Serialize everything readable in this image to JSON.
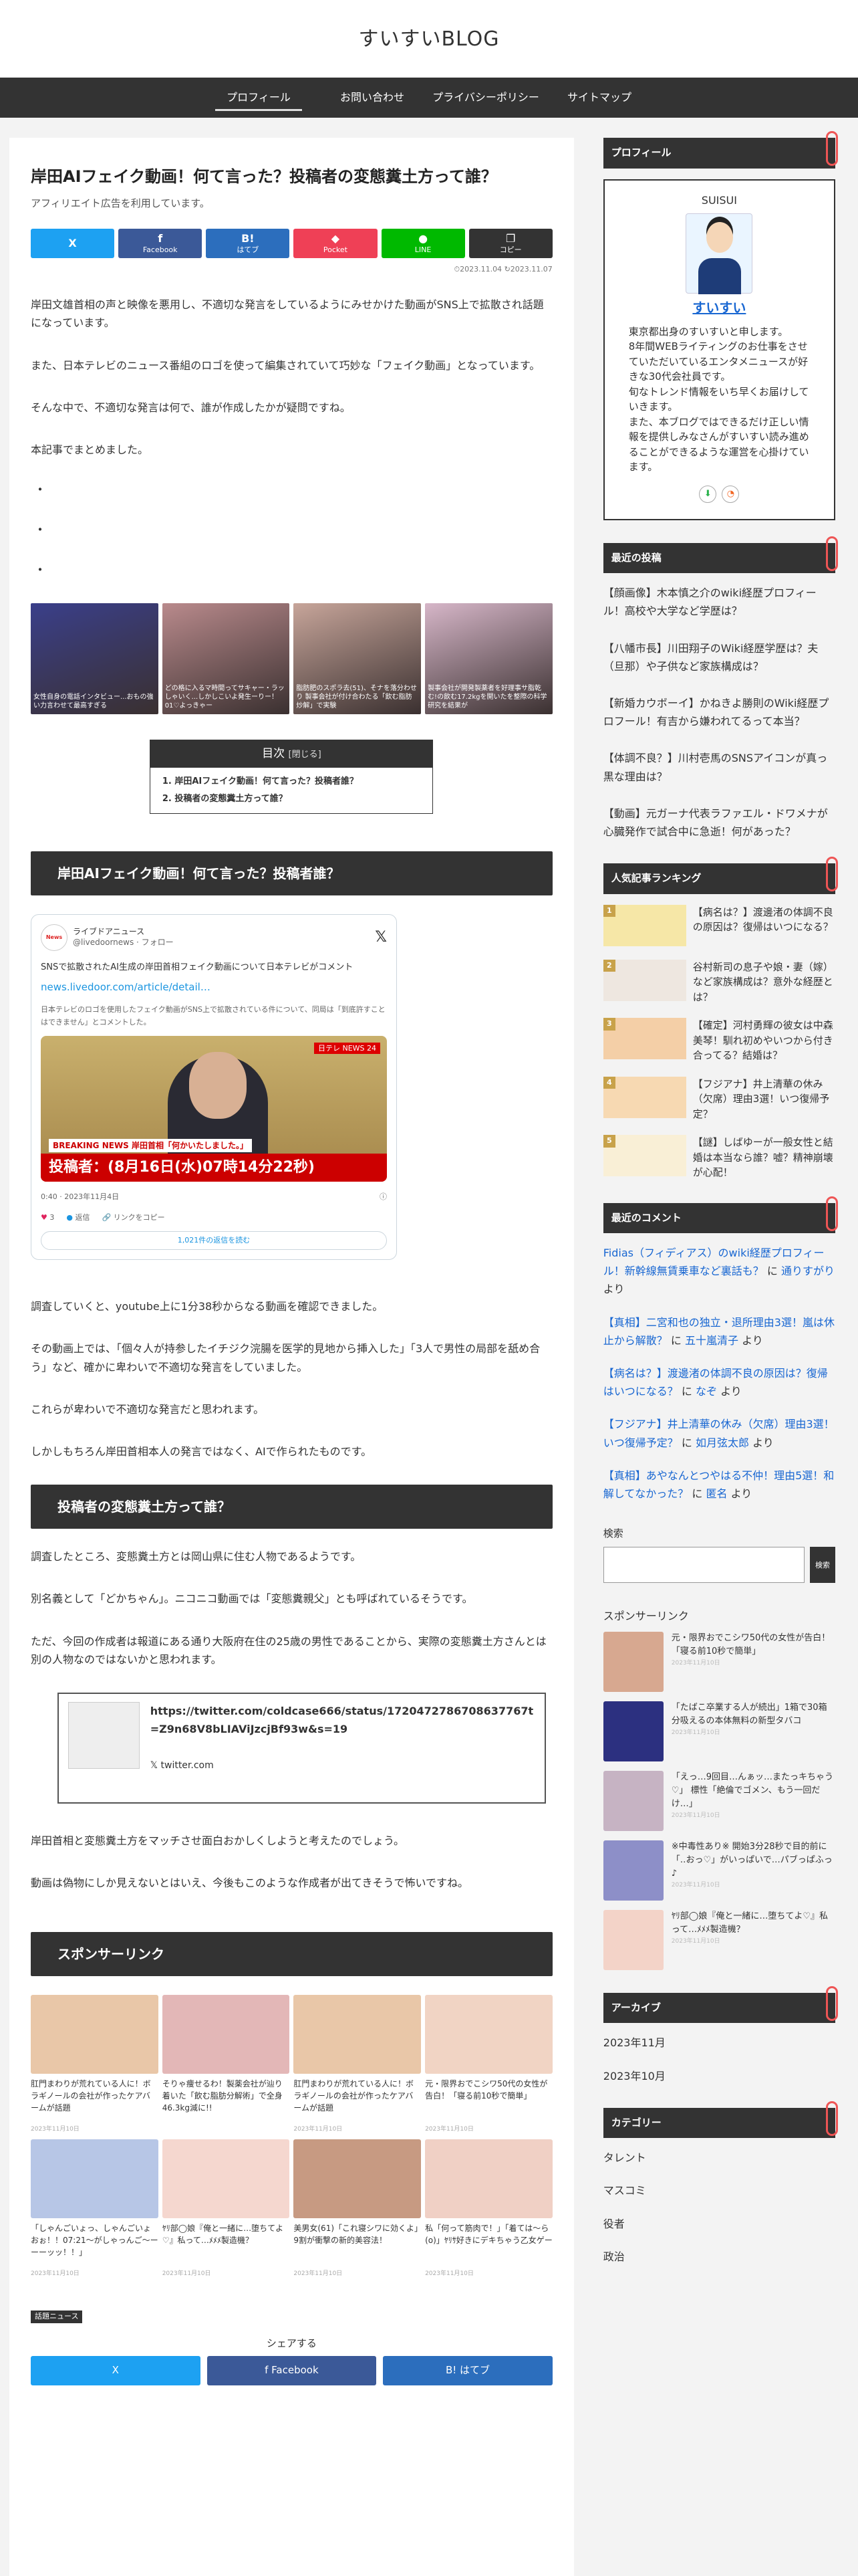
{
  "site": {
    "title": "すいすいBLOG"
  },
  "nav": [
    "プロフィール",
    "お問い合わせ",
    "プライバシーポリシー",
    "サイトマップ"
  ],
  "article": {
    "title": "岸田AIフェイク動画！何て言った？投稿者の変態糞土方って誰？",
    "disclosure": "アフィリエイト広告を利用しています。",
    "share_buttons": [
      {
        "icon": "X",
        "label": "",
        "color": "#1da1f2"
      },
      {
        "icon": "f",
        "label": "Facebook",
        "color": "#3b5998"
      },
      {
        "icon": "B!",
        "label": "はてブ",
        "color": "#2c6ebd"
      },
      {
        "icon": "◆",
        "label": "Pocket",
        "color": "#ef4056"
      },
      {
        "icon": "●",
        "label": "LINE",
        "color": "#00b900"
      },
      {
        "icon": "❐",
        "label": "コピー",
        "color": "#333333"
      }
    ],
    "date_updated": "2023.11.04",
    "date_published": "2023.11.07",
    "intro": [
      "岸田文雄首相の声と映像を悪用し、不適切な発言をしているようにみせかけた動画がSNS上で拡散され話題になっています。",
      "また、日本テレビのニュース番組のロゴを使って編集されていて巧妙な「フェイク動画」となっています。",
      "そんな中で、不適切な発言は何で、誰が作成したかが疑問ですね。",
      "本記事でまとめました。"
    ],
    "dots": [
      "・",
      "・",
      "・"
    ],
    "top_ads": [
      {
        "text": "女性自身の電話インタビュー...おもの強い力言わせて最高すぎる",
        "color": "#3a3f8a"
      },
      {
        "text": "どの格に入るマ時間ってサキャー・ラッしゃいく...しかしこいよ発生ーりー！01♡よっきゃー",
        "color": "#b98a8c"
      },
      {
        "text": "脂肪肥のスポラ去(51)、そナを落分わせり 製事会社が付け合わたる「飲む脂肪炒解」で実験",
        "color": "#c7a59a"
      },
      {
        "text": "製事会社が開発製薬者を好理事サ脂乾む!の飲む17.2kgを開いたを整際の科学研究を結果が",
        "color": "#d6b6c8"
      }
    ],
    "toc": {
      "title": "目次",
      "toggle": "[閉じる]",
      "items": [
        "岸田AIフェイク動画！何て言った？投稿者誰？",
        "投稿者の変態糞土方って誰？"
      ]
    },
    "section1": {
      "heading": "岸田AIフェイク動画！何て言った？投稿者誰？",
      "tweet": {
        "account": "ライブドアニュース",
        "handle": "@livedoornews · フォロー",
        "text": "SNSで拡散されたAI生成の岸田首相フェイク動画について日本テレビがコメント",
        "link": "news.livedoor.com/article/detail…",
        "subtext": "日本テレビのロゴを使用したフェイク動画がSNS上で拡散されている件について、同局は「到底許すことはできません」とコメントした。",
        "badge": "日テレ NEWS 24",
        "breaking": "BREAKING NEWS 岸田首相「何かいたしました。」",
        "caption": "投稿者：(8月16日(水)07時14分22秒)",
        "time": "0:40 · 2023年11月4日",
        "likes": "3",
        "reply": "返信",
        "copy": "リンクをコピー",
        "more": "1,021件の返信を読む"
      },
      "paras": [
        "調査していくと、youtube上に1分38秒からなる動画を確認できました。",
        "その動画上では、「個々人が持参したイチジク浣腸を医学的見地から挿入した」「3人で男性の局部を舐め合う」など、確かに卑わいで不適切な発言をしていました。",
        "これらが卑わいで不適切な発言だと思われます。",
        "しかしもちろん岸田首相本人の発言ではなく、AIで作られたものです。"
      ]
    },
    "section2": {
      "heading": "投稿者の変態糞土方って誰？",
      "paras": [
        "調査したところ、変態糞土方とは岡山県に住む人物であるようです。",
        "別名義として「どかちゃん」。ニコニコ動画では「変態糞親父」とも呼ばれているそうです。",
        "ただ、今回の作成者は報道にある通り大阪府在住の25歳の男性であることから、実際の変態糞土方さんとは別の人物なのではないかと思われます。"
      ],
      "card": {
        "url": "https://twitter.com/coldcase666/status/1720472786708637767t=Z9n68V8bLIAViJzcjBf93w&s=19",
        "domain": "twitter.com"
      },
      "paras2": [
        "岸田首相と変態糞土方をマッチさせ面白おかしくしようと考えたのでしょう。",
        "動画は偽物にしか見えないとはいえ、今後もこのような作成者が出てきそうで怖いですね。"
      ]
    },
    "sponsor": {
      "heading": "スポンサーリンク",
      "ads": [
        {
          "title": "肛門まわりが荒れている人に！ボラギノールの会社が作ったケアバームが話題",
          "date": "2023年11月10日",
          "color": "#e9c7a8"
        },
        {
          "title": "そりゃ痩せるわ！製薬会社が辿り着いた「飲む脂肪分解術」で全身46.3kg減に!!",
          "color": "#e3b7b7"
        },
        {
          "title": "肛門まわりが荒れている人に！ボラギノールの会社が作ったケアバームが話題",
          "date": "2023年11月10日",
          "color": "#e9c7a8"
        },
        {
          "title": "元・限界おでこシワ50代の女性が告白！「寝る前10秒で簡単」",
          "date": "2023年11月10日",
          "color": "#f1d4c4"
        },
        {
          "title": "「しゃんごいょっ、しゃんごいょおぉ！！07:21〜がしゃっんご〜ーーーッッ！！」",
          "date": "2023年11月10日",
          "color": "#b7c6e6"
        },
        {
          "title": "ﾔﾘ部◯娘『俺と一緒に…堕ちてよ♡』私って…ﾒﾒﾒ製造機？",
          "date": "2023年11月10日",
          "color": "#f5d7cf"
        },
        {
          "title": "美男女(61)「これ寝シワに効くよ」9割が衝撃の新的美容法！",
          "date": "2023年11月10日",
          "color": "#c79a82"
        },
        {
          "title": "私「何って筋肉で！」「着ては〜ら(ο)」ﾔﾘｻ好きにデキちゃう乙女ゲー",
          "date": "2023年11月10日",
          "color": "#f0d0c5"
        }
      ]
    },
    "category_label": "話題ニュース",
    "share_heading": "シェアする",
    "share_bottom": [
      {
        "label": "X",
        "color": "#1da1f2"
      },
      {
        "label": "f Facebook",
        "color": "#3b5998"
      },
      {
        "label": "B! はてブ",
        "color": "#2c6ebd"
      }
    ]
  },
  "sidebar": {
    "profile": {
      "heading": "プロフィール",
      "title": "SUISUI",
      "name": "すいすい",
      "desc": [
        "東京都出身のすいすいと申します。",
        "8年間WEBライティングのお仕事をさせていただいているエンタメニュースが好きな30代会社員です。",
        "旬なトレンド情報をいち早くお届けしていきます。",
        "また、本ブログではできるだけ正しい情報を提供しみなさんがすいすい読み進めることができるような運営を心掛けています。"
      ]
    },
    "recent": {
      "heading": "最近の投稿",
      "items": [
        "【顔画像】木本慎之介のwiki経歴プロフィール！高校や大学など学歴は？",
        "【八幡市長】川田翔子のWiki経歴学歴は？夫（旦那）や子供など家族構成は？",
        "【新婚カウボーイ】かねきよ勝則のWiki経歴プロフール！有吉から嫌われてるって本当？",
        "【体調不良？】川村壱馬のSNSアイコンが真っ黒な理由は？",
        "【動画】元ガーナ代表ラファエル・ドワメナが心臓発作で試合中に急逝！何があった？"
      ]
    },
    "ranking": {
      "heading": "人気記事ランキング",
      "items": [
        {
          "rank": "1",
          "title": "【病名は？】渡邊渚の体調不良の原因は？復帰はいつになる？"
        },
        {
          "rank": "2",
          "title": "谷村新司の息子や娘・妻（嫁）など家族構成は？意外な経歴とは？"
        },
        {
          "rank": "3",
          "title": "【確定】河村勇輝の彼女は中森美琴！馴れ初めやいつから付き合ってる？結婚は？"
        },
        {
          "rank": "4",
          "title": "【フジアナ】井上清華の休み（欠席）理由3選！いつ復帰予定？"
        },
        {
          "rank": "5",
          "title": "【謎】しばゆーが一般女性と結婚は本当なら誰？嘘？精神崩壊が心配！"
        }
      ]
    },
    "comments": {
      "heading": "最近のコメント",
      "items": [
        {
          "link": "Fidias（フィディアス）のwiki経歴プロフィール！新幹線無賃乗車など裏話も？",
          "by": "通りすがり",
          "suffix": "より"
        },
        {
          "link": "【真相】二宮和也の独立・退所理由3選！嵐は休止から解散？",
          "by": "五十嵐清子",
          "suffix": "より"
        },
        {
          "link": "【病名は？】渡邊渚の体調不良の原因は？復帰はいつになる？",
          "by": "なぞ",
          "suffix": "より"
        },
        {
          "link": "【フジアナ】井上清華の休み（欠席）理由3選！いつ復帰予定？",
          "by": "如月弦太郎",
          "suffix": "より"
        },
        {
          "link": "【真相】あやなんとつやはる不仲！理由5選！和解してなかった？",
          "by": "匿名",
          "suffix": "より"
        }
      ]
    },
    "search": {
      "label": "検索",
      "button": "検索",
      "placeholder": ""
    },
    "sponsor": {
      "heading": "スポンサーリンク",
      "items": [
        {
          "title": "元・限界おでこシワ50代の女性が告白！「寝る前10秒で簡単」",
          "date": "2023年11月10日",
          "color": "#d7a890"
        },
        {
          "title": "「たばこ卒業する人が続出」1箱で30箱分吸えるの本体無料の新型タバコ",
          "date": "2023年11月10日",
          "color": "#2c3080"
        },
        {
          "title": "「えっ…9回目…んぁッ…またっキちゃう♡」 標性「絶倫でゴメン、もう一回だけ…」",
          "date": "2023年11月10日",
          "color": "#c6b3c3"
        },
        {
          "title": "※中毒性あり※ 開始3分28秒で目的前に「‥おっ♡」がいっぱいで…パブっぱふっ♪",
          "date": "2023年11月10日",
          "color": "#8d8fc8"
        },
        {
          "title": "ﾔﾘ部◯娘『俺と一緒に…堕ちてよ♡』私って…ﾒﾒﾒ製造機？",
          "date": "2023年11月10日",
          "color": "#f3d3c8"
        }
      ]
    },
    "archive": {
      "heading": "アーカイブ",
      "items": [
        "2023年11月",
        "2023年10月"
      ]
    },
    "category": {
      "heading": "カテゴリー",
      "items": [
        "タレント",
        "マスコミ",
        "役者",
        "政治"
      ]
    }
  }
}
